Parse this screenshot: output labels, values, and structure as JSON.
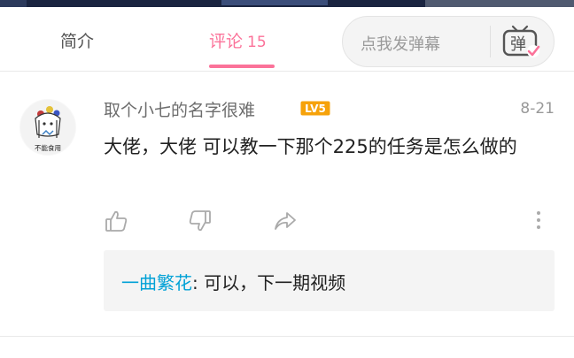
{
  "tabs": {
    "intro_label": "简介",
    "comments_label": "评论",
    "comments_count": "15"
  },
  "danmaku": {
    "placeholder": "点我发弹幕",
    "button_glyph": "弹",
    "icon": "danmaku-tv-icon"
  },
  "comment": {
    "username": "取个小七的名字很难",
    "level": "LV5",
    "date": "8-21",
    "content": "大佬，大佬  可以教一下那个225的任务是怎么做的",
    "avatar_caption": "不能食用"
  },
  "actions": {
    "like_icon": "thumbs-up-icon",
    "dislike_icon": "thumbs-down-icon",
    "share_icon": "share-icon",
    "more_icon": "more-vertical-icon"
  },
  "reply": {
    "username": "一曲繁花",
    "text": ": 可以，下一期视频"
  },
  "colors": {
    "accent": "#fb7299",
    "link_blue": "#00a1d6",
    "level_badge": "#f6a20a"
  }
}
